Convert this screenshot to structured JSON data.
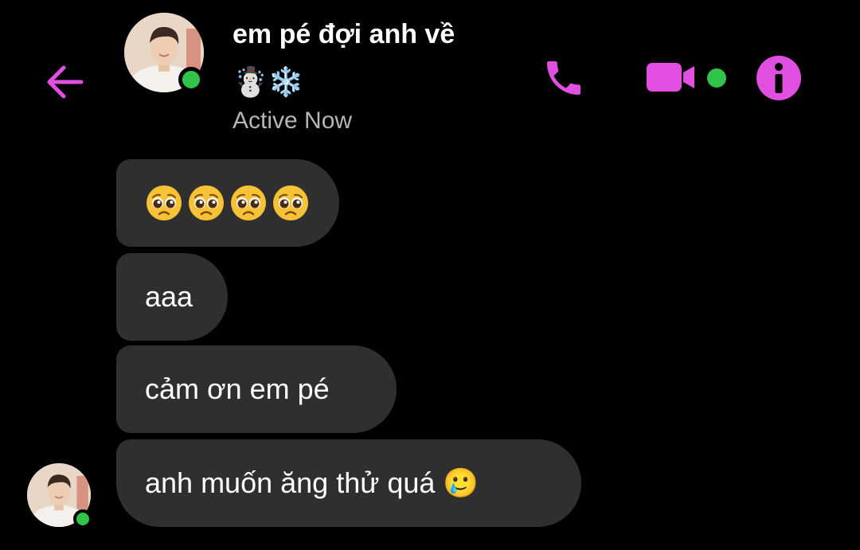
{
  "header": {
    "back_icon": "arrow-left-icon",
    "contact_name": "em pé đợi anh về",
    "contact_emoji": "☃️❄️",
    "status": "Active Now",
    "actions": {
      "call_icon": "phone-icon",
      "video_icon": "video-camera-icon",
      "info_icon": "info-icon"
    }
  },
  "messages": [
    {
      "type": "emoji",
      "text": "🥺🥺🥺🥺"
    },
    {
      "type": "text",
      "text": "aaa"
    },
    {
      "type": "text",
      "text": "cảm ơn em pé"
    },
    {
      "type": "text",
      "text": "anh muốn ăng thử quá 🥲"
    }
  ],
  "colors": {
    "accent": "#e04fe0",
    "online": "#31c44a",
    "bubble": "#2f2f2f",
    "background": "#000000",
    "secondary_text": "#b6b6b6"
  }
}
